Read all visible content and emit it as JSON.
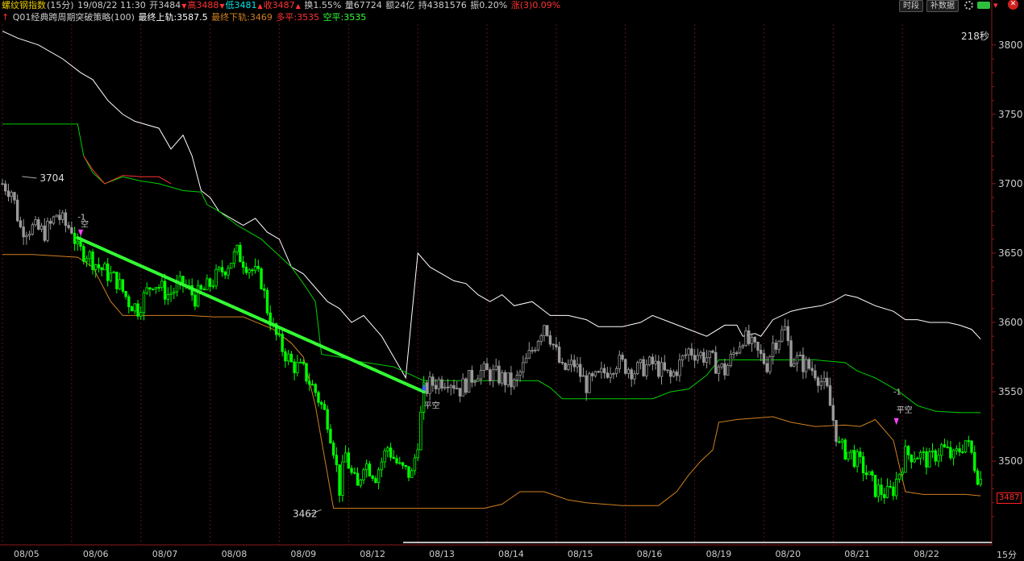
{
  "header": {
    "line1": {
      "symbol": "螺纹钢指数",
      "period": "(15分)",
      "datetime": "19/08/22 11:30",
      "open": "开3484",
      "high": "高3488",
      "low": "低3481",
      "close": "收3487",
      "turnover_rate": "换1.55%",
      "volume": "量67724",
      "amount": "额24亿",
      "open_interest": "持4381576",
      "amplitude": "振0.20%",
      "change": "涨(3)0.09%"
    },
    "line2": {
      "strategy": "Q01经典跨周期突破策略(100)",
      "upper": "最终上轨:3587.5",
      "lower": "最终下轨:3469",
      "long_flat": "多平:3535",
      "short_flat": "空平:3535"
    }
  },
  "toolbar": {
    "segment_btn": "时段",
    "fill_btn": "补数据"
  },
  "timer": "218秒",
  "corner_period": "15分",
  "colors": {
    "bg": "#000000",
    "up": "#ff3232",
    "down": "#00e6e6",
    "grey_k": "#9a9a9a",
    "green_k": "#00ff00",
    "white_line": "#ffffff",
    "green_line": "#00d000",
    "orange_line": "#d08020",
    "trend": "#33ff33",
    "price_box": "#ff2020",
    "yellow": "#e6c800",
    "axis_text": "#cccccc"
  },
  "chart_data": {
    "type": "candlestick",
    "y_axis": {
      "ticks": [
        3500,
        3550,
        3600,
        3650,
        3700,
        3750,
        3800
      ],
      "range": [
        3455,
        3830
      ]
    },
    "x_axis": {
      "labels": [
        "08/05",
        "08/06",
        "08/07",
        "08/08",
        "08/09",
        "08/12",
        "08/13",
        "08/14",
        "08/15",
        "08/16",
        "08/19",
        "08/20",
        "08/21",
        "08/22"
      ]
    },
    "bars_per_day": 23,
    "close_path": [
      [
        0,
        3700
      ],
      [
        3,
        3695
      ],
      [
        6,
        3668
      ],
      [
        10,
        3668
      ],
      [
        14,
        3665
      ],
      [
        16,
        3670
      ],
      [
        18,
        3678
      ],
      [
        21,
        3670
      ],
      [
        23,
        3668
      ],
      [
        25,
        3652
      ],
      [
        28,
        3650
      ],
      [
        32,
        3640
      ],
      [
        38,
        3630
      ],
      [
        42,
        3615
      ],
      [
        45,
        3610
      ],
      [
        50,
        3630
      ],
      [
        55,
        3620
      ],
      [
        60,
        3628
      ],
      [
        64,
        3618
      ],
      [
        68,
        3625
      ],
      [
        72,
        3635
      ],
      [
        78,
        3650
      ],
      [
        82,
        3640
      ],
      [
        86,
        3630
      ],
      [
        88,
        3610
      ],
      [
        90,
        3595
      ],
      [
        92,
        3585
      ],
      [
        96,
        3570
      ],
      [
        100,
        3565
      ],
      [
        104,
        3550
      ],
      [
        108,
        3530
      ],
      [
        110,
        3510
      ],
      [
        112,
        3480
      ],
      [
        114,
        3505
      ],
      [
        116,
        3490
      ],
      [
        118,
        3480
      ],
      [
        120,
        3500
      ],
      [
        124,
        3490
      ],
      [
        128,
        3510
      ],
      [
        132,
        3495
      ],
      [
        136,
        3490
      ],
      [
        138,
        3515
      ],
      [
        140,
        3550
      ],
      [
        142,
        3555
      ],
      [
        148,
        3560
      ],
      [
        152,
        3552
      ],
      [
        158,
        3565
      ],
      [
        164,
        3562
      ],
      [
        170,
        3555
      ],
      [
        176,
        3580
      ],
      [
        180,
        3600
      ],
      [
        182,
        3590
      ],
      [
        186,
        3565
      ],
      [
        190,
        3570
      ],
      [
        194,
        3555
      ],
      [
        198,
        3560
      ],
      [
        204,
        3572
      ],
      [
        210,
        3565
      ],
      [
        216,
        3570
      ],
      [
        222,
        3560
      ],
      [
        228,
        3580
      ],
      [
        234,
        3575
      ],
      [
        240,
        3565
      ],
      [
        246,
        3590
      ],
      [
        250,
        3580
      ],
      [
        254,
        3570
      ],
      [
        256,
        3585
      ],
      [
        260,
        3595
      ],
      [
        262,
        3575
      ],
      [
        266,
        3570
      ],
      [
        270,
        3565
      ],
      [
        274,
        3550
      ],
      [
        276,
        3530
      ],
      [
        278,
        3510
      ],
      [
        282,
        3505
      ],
      [
        286,
        3495
      ],
      [
        290,
        3480
      ],
      [
        294,
        3476
      ],
      [
        296,
        3480
      ],
      [
        300,
        3505
      ],
      [
        304,
        3505
      ],
      [
        308,
        3500
      ],
      [
        312,
        3510
      ],
      [
        316,
        3502
      ],
      [
        320,
        3515
      ],
      [
        322,
        3505
      ],
      [
        324,
        3490
      ],
      [
        325,
        3487
      ]
    ],
    "green_bar_ranges": [
      [
        24,
        140
      ],
      [
        278,
        325
      ]
    ],
    "series": [
      {
        "name": "upper_channel",
        "points": [
          [
            0,
            3810
          ],
          [
            5,
            3805
          ],
          [
            12,
            3800
          ],
          [
            20,
            3790
          ],
          [
            26,
            3780
          ],
          [
            30,
            3775
          ],
          [
            35,
            3760
          ],
          [
            40,
            3750
          ],
          [
            44,
            3745
          ],
          [
            52,
            3740
          ],
          [
            56,
            3725
          ],
          [
            60,
            3735
          ],
          [
            63,
            3720
          ],
          [
            66,
            3695
          ],
          [
            69,
            3690
          ],
          [
            72,
            3680
          ],
          [
            76,
            3675
          ],
          [
            80,
            3670
          ],
          [
            84,
            3675
          ],
          [
            88,
            3665
          ],
          [
            92,
            3660
          ],
          [
            96,
            3640
          ],
          [
            100,
            3635
          ],
          [
            104,
            3625
          ],
          [
            108,
            3615
          ],
          [
            112,
            3610
          ],
          [
            116,
            3600
          ],
          [
            120,
            3605
          ],
          [
            124,
            3595
          ],
          [
            126,
            3590
          ],
          [
            130,
            3575
          ],
          [
            134,
            3560
          ],
          [
            138,
            3650
          ],
          [
            142,
            3640
          ],
          [
            146,
            3635
          ],
          [
            150,
            3630
          ],
          [
            154,
            3628
          ],
          [
            158,
            3620
          ],
          [
            162,
            3615
          ],
          [
            166,
            3620
          ],
          [
            170,
            3612
          ],
          [
            176,
            3615
          ],
          [
            182,
            3605
          ],
          [
            188,
            3605
          ],
          [
            194,
            3602
          ],
          [
            198,
            3597
          ],
          [
            206,
            3597
          ],
          [
            212,
            3600
          ],
          [
            216,
            3605
          ],
          [
            222,
            3600
          ],
          [
            228,
            3595
          ],
          [
            234,
            3590
          ],
          [
            240,
            3598
          ],
          [
            244,
            3598
          ],
          [
            246,
            3590
          ],
          [
            250,
            3592
          ],
          [
            252,
            3590
          ],
          [
            256,
            3602
          ],
          [
            262,
            3608
          ],
          [
            266,
            3610
          ],
          [
            272,
            3612
          ],
          [
            276,
            3615
          ],
          [
            280,
            3620
          ],
          [
            284,
            3618
          ],
          [
            290,
            3612
          ],
          [
            296,
            3608
          ],
          [
            300,
            3602
          ],
          [
            304,
            3602
          ],
          [
            308,
            3600
          ],
          [
            314,
            3600
          ],
          [
            318,
            3598
          ],
          [
            322,
            3595
          ],
          [
            325,
            3588
          ]
        ]
      },
      {
        "name": "middle_channel_green",
        "points": [
          [
            0,
            3743
          ],
          [
            25,
            3743
          ],
          [
            27,
            3720
          ],
          [
            30,
            3708
          ],
          [
            34,
            3700
          ],
          [
            40,
            3705
          ],
          [
            46,
            3702
          ],
          [
            52,
            3700
          ],
          [
            60,
            3695
          ],
          [
            66,
            3694
          ],
          [
            68,
            3685
          ],
          [
            72,
            3680
          ],
          [
            78,
            3670
          ],
          [
            82,
            3665
          ],
          [
            86,
            3660
          ],
          [
            90,
            3652
          ],
          [
            96,
            3640
          ],
          [
            100,
            3628
          ],
          [
            104,
            3615
          ],
          [
            106,
            3577
          ],
          [
            112,
            3575
          ],
          [
            118,
            3572
          ],
          [
            124,
            3570
          ],
          [
            130,
            3568
          ],
          [
            136,
            3562
          ],
          [
            140,
            3558
          ],
          [
            144,
            3558
          ],
          [
            150,
            3558
          ],
          [
            156,
            3558
          ],
          [
            162,
            3558
          ],
          [
            170,
            3558
          ],
          [
            178,
            3558
          ],
          [
            182,
            3553
          ],
          [
            186,
            3545
          ],
          [
            190,
            3545
          ],
          [
            200,
            3545
          ],
          [
            210,
            3545
          ],
          [
            216,
            3545
          ],
          [
            222,
            3550
          ],
          [
            228,
            3552
          ],
          [
            234,
            3562
          ],
          [
            238,
            3573
          ],
          [
            244,
            3573
          ],
          [
            250,
            3573
          ],
          [
            256,
            3573
          ],
          [
            262,
            3573
          ],
          [
            270,
            3573
          ],
          [
            280,
            3571
          ],
          [
            284,
            3565
          ],
          [
            290,
            3560
          ],
          [
            294,
            3555
          ],
          [
            298,
            3550
          ],
          [
            304,
            3540
          ],
          [
            310,
            3536
          ],
          [
            318,
            3535
          ],
          [
            325,
            3535
          ]
        ]
      },
      {
        "name": "middle_channel_red",
        "points": [
          [
            27,
            3720
          ],
          [
            30,
            3710
          ],
          [
            34,
            3700
          ],
          [
            40,
            3706
          ],
          [
            46,
            3705
          ],
          [
            52,
            3705
          ],
          [
            56,
            3700
          ]
        ]
      },
      {
        "name": "lower_channel",
        "points": [
          [
            0,
            3649
          ],
          [
            10,
            3649
          ],
          [
            25,
            3647
          ],
          [
            30,
            3640
          ],
          [
            36,
            3615
          ],
          [
            40,
            3605
          ],
          [
            46,
            3605
          ],
          [
            56,
            3605
          ],
          [
            62,
            3605
          ],
          [
            70,
            3604
          ],
          [
            80,
            3604
          ],
          [
            90,
            3595
          ],
          [
            96,
            3585
          ],
          [
            100,
            3575
          ],
          [
            104,
            3540
          ],
          [
            110,
            3466
          ],
          [
            120,
            3466
          ],
          [
            140,
            3466
          ],
          [
            150,
            3466
          ],
          [
            160,
            3466
          ],
          [
            166,
            3469
          ],
          [
            172,
            3478
          ],
          [
            180,
            3478
          ],
          [
            184,
            3475
          ],
          [
            188,
            3472
          ],
          [
            194,
            3470
          ],
          [
            200,
            3469
          ],
          [
            206,
            3468
          ],
          [
            212,
            3468
          ],
          [
            218,
            3468
          ],
          [
            224,
            3478
          ],
          [
            228,
            3490
          ],
          [
            232,
            3500
          ],
          [
            236,
            3508
          ],
          [
            238,
            3528
          ],
          [
            244,
            3530
          ],
          [
            250,
            3531
          ],
          [
            256,
            3532
          ],
          [
            262,
            3528
          ],
          [
            270,
            3525
          ],
          [
            280,
            3526
          ],
          [
            285,
            3525
          ],
          [
            290,
            3530
          ],
          [
            296,
            3515
          ],
          [
            300,
            3478
          ],
          [
            306,
            3476
          ],
          [
            314,
            3476
          ],
          [
            320,
            3476
          ],
          [
            325,
            3475
          ]
        ]
      }
    ],
    "trend_line": {
      "from": [
        25,
        3661
      ],
      "to": [
        140,
        3550
      ]
    },
    "annotations": [
      {
        "text": "3704",
        "bar": 6,
        "price": 3704
      },
      {
        "text": "3462",
        "bar": 90,
        "price": 3462
      },
      {
        "text": "-1",
        "bar": 25,
        "price": 3674
      },
      {
        "text": "空",
        "bar": 26,
        "price": 3669
      },
      {
        "text": "平空",
        "bar": 140,
        "price": 3538
      },
      {
        "text": "-1",
        "bar": 296,
        "price": 3548
      },
      {
        "text": "平空",
        "bar": 297,
        "price": 3535
      }
    ],
    "last_price": "3487"
  }
}
